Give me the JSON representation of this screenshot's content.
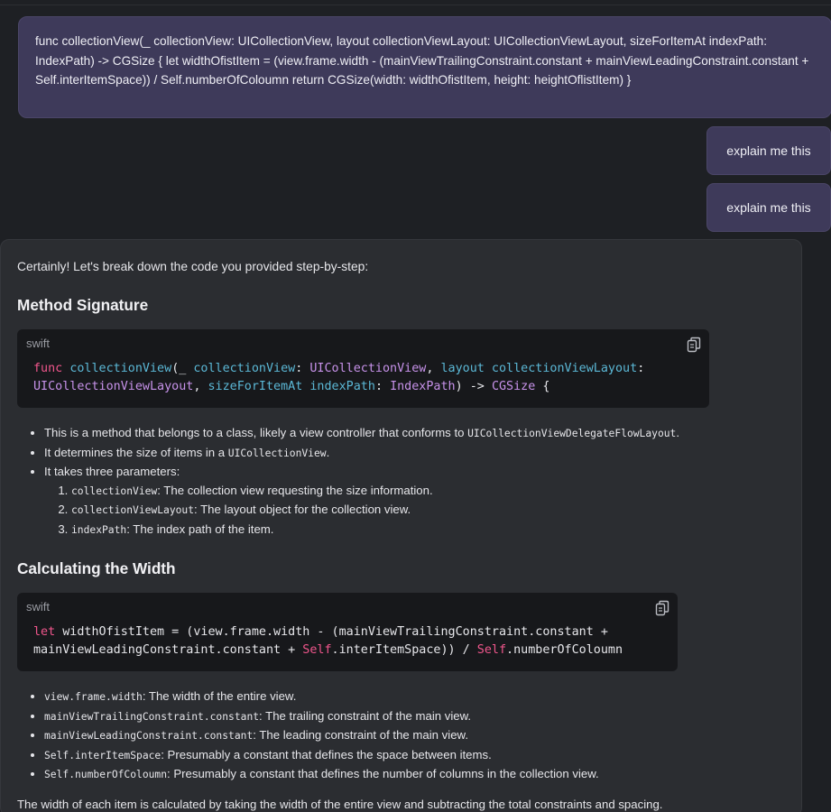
{
  "conversation": {
    "user_message": "func collectionView(_ collectionView: UICollectionView, layout collectionViewLayout: UICollectionViewLayout, sizeForItemAt indexPath: IndexPath) -> CGSize { let widthOfistItem = (view.frame.width - (mainViewTrailingConstraint.constant + mainViewLeadingConstraint.constant + Self.interItemSpace)) / Self.numberOfColoumn return CGSize(width: widthOfistItem, height: heightOflistItem) }",
    "follow_ups": [
      "explain me this",
      "explain me this"
    ]
  },
  "response": {
    "intro": "Certainly! Let's break down the code you provided step-by-step:",
    "section1": {
      "heading": "Method Signature",
      "code": {
        "lang": "swift",
        "tokens": {
          "func": "func",
          "name": "collectionView",
          "p1": "(_ ",
          "p1name": "collectionView",
          "colon1": ": ",
          "t1": "UICollectionView",
          "comma1": ", ",
          "label2": "layout",
          "p2name": " collectionViewLayout",
          "colon2": ":",
          "t2": "UICollectionViewLayout",
          "comma2": ", ",
          "label3": "sizeForItemAt",
          "p3name": " indexPath",
          "colon3": ": ",
          "t3": "IndexPath",
          "arrow": ") -> ",
          "t4": "CGSize",
          "brace": " {"
        }
      },
      "bullets": [
        {
          "text": "This is a method that belongs to a class, likely a view controller that conforms to ",
          "code": "UICollectionViewDelegateFlowLayout",
          "after": "."
        },
        {
          "text": "It determines the size of items in a ",
          "code": "UICollectionView",
          "after": "."
        },
        {
          "text": "It takes three parameters:"
        }
      ],
      "params": [
        {
          "code": "collectionView",
          "text": ": The collection view requesting the size information."
        },
        {
          "code": "collectionViewLayout",
          "text": ": The layout object for the collection view."
        },
        {
          "code": "indexPath",
          "text": ": The index path of the item."
        }
      ]
    },
    "section2": {
      "heading": "Calculating the Width",
      "code": {
        "lang": "swift",
        "tokens": {
          "let": "let",
          "l1rest": " widthOfistItem = (view.frame.width - (mainViewTrailingConstraint.constant +",
          "l2a": "mainViewLeadingConstraint.constant + ",
          "self1": "Self",
          "l2b": ".interItemSpace)) / ",
          "self2": "Self",
          "l2c": ".numberOfColoumn"
        }
      },
      "bullets": [
        {
          "code": "view.frame.width",
          "text": ": The width of the entire view."
        },
        {
          "code": "mainViewTrailingConstraint.constant",
          "text": ": The trailing constraint of the main view."
        },
        {
          "code": "mainViewLeadingConstraint.constant",
          "text": ": The leading constraint of the main view."
        },
        {
          "code": "Self.interItemSpace",
          "text": ": Presumably a constant that defines the space between items."
        },
        {
          "code": "Self.numberOfColoumn",
          "text": ": Presumably a constant that defines the number of columns in the collection view."
        }
      ],
      "cut_text": "The width of each item is calculated by taking the width of the entire view and subtracting the total constraints and spacing."
    }
  },
  "icons": {
    "copy": "copy-icon"
  }
}
